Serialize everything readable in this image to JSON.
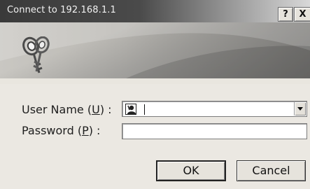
{
  "window": {
    "title": "Connect to 192.168.1.1",
    "help_button": "?",
    "close_button": "X"
  },
  "form": {
    "username_label": "User Name",
    "username_key": "U",
    "username_suffix": ") :",
    "username_value": "",
    "password_label": "Password",
    "password_key": "P",
    "password_suffix": ") :",
    "password_value": ""
  },
  "buttons": {
    "ok": "OK",
    "cancel": "Cancel"
  },
  "icons": {
    "banner": "keys-icon",
    "user_field": "user-icon",
    "dropdown": "chevron-down-icon"
  }
}
